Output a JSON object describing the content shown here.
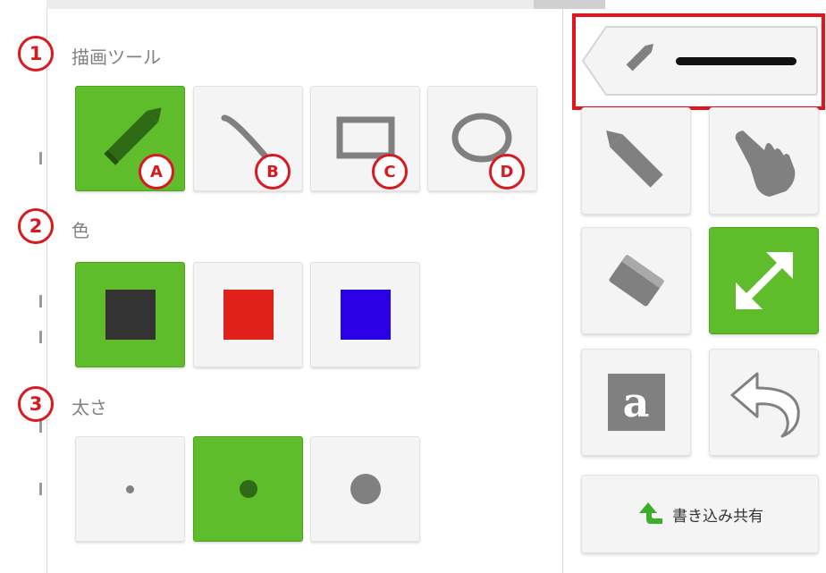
{
  "settings_panel": {
    "sections": [
      {
        "number": "1",
        "label": "描画ツール"
      },
      {
        "number": "2",
        "label": "色"
      },
      {
        "number": "3",
        "label": "太さ"
      }
    ],
    "tools": [
      {
        "icon": "pencil-icon",
        "badge": "A",
        "selected": true
      },
      {
        "icon": "line-icon",
        "badge": "B",
        "selected": false
      },
      {
        "icon": "rectangle-icon",
        "badge": "C",
        "selected": false
      },
      {
        "icon": "ellipse-icon",
        "badge": "D",
        "selected": false
      }
    ],
    "colors": [
      {
        "name": "black",
        "hex": "#333333",
        "selected": true
      },
      {
        "name": "red",
        "hex": "#e0201b",
        "selected": false
      },
      {
        "name": "blue",
        "hex": "#2b00e6",
        "selected": false
      }
    ],
    "thickness": [
      {
        "name": "thin",
        "selected": false
      },
      {
        "name": "medium",
        "selected": true
      },
      {
        "name": "thick",
        "selected": false
      }
    ]
  },
  "toolbar": {
    "current_pen": {
      "icon": "pencil-icon",
      "color": "#111111"
    },
    "buttons": [
      {
        "icon": "pencil-icon",
        "selected": false
      },
      {
        "icon": "hand-pointer-icon",
        "selected": false
      },
      {
        "icon": "eraser-icon",
        "selected": false
      },
      {
        "icon": "resize-arrows-icon",
        "selected": true
      },
      {
        "icon": "text-icon",
        "glyph": "a",
        "selected": false
      },
      {
        "icon": "undo-icon",
        "selected": false
      }
    ],
    "share_button": {
      "label": "書き込み共有",
      "icon": "share-arrow-icon"
    }
  },
  "colors": {
    "selected_green": "#5fbd2b",
    "annotation_red": "#d71920",
    "icon_gray": "#808080"
  }
}
